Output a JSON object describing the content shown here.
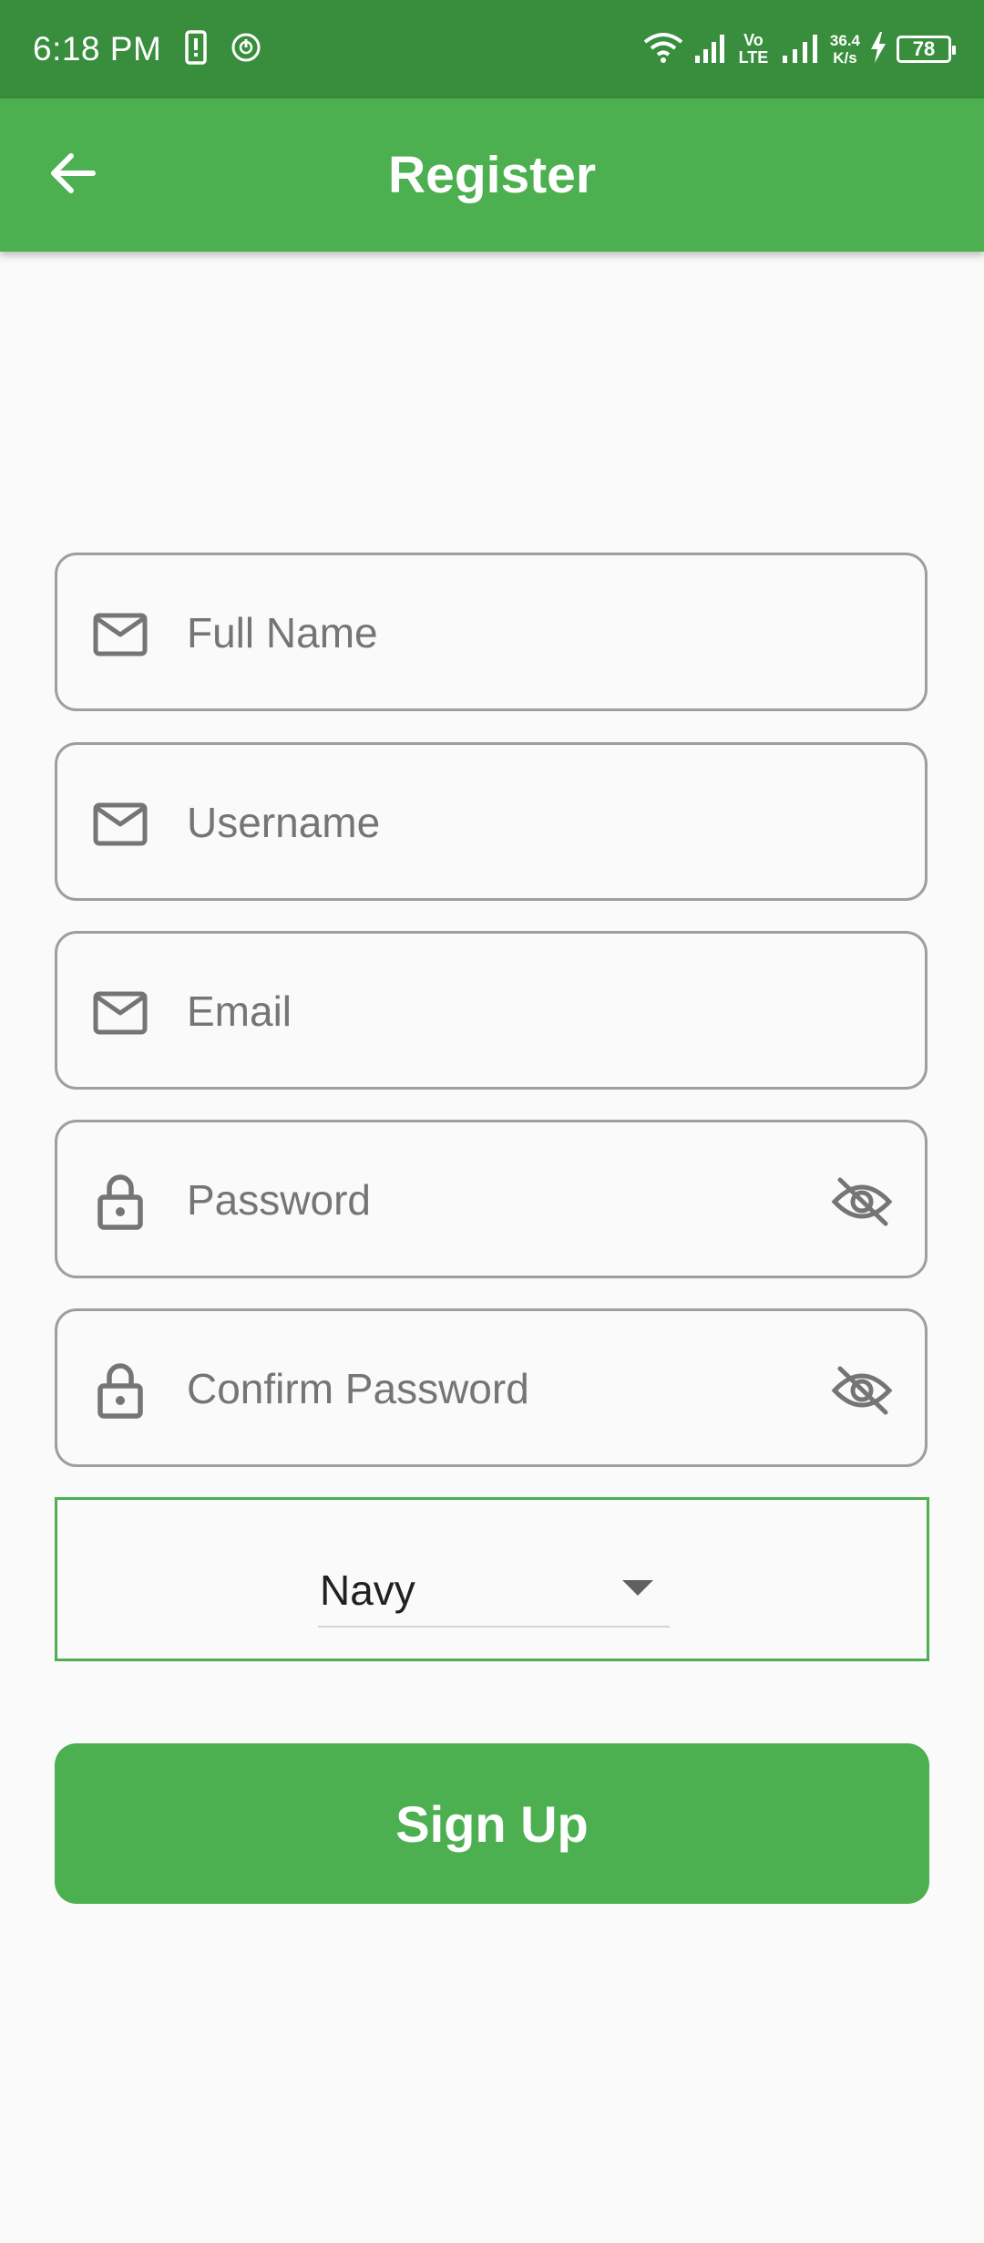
{
  "status_bar": {
    "time": "6:18 PM",
    "network_type": "Vo LTE",
    "net_speed_value": "36.4",
    "net_speed_unit": "K/s",
    "battery_level": "78",
    "icons": [
      "sim-alert-icon",
      "circle-power-icon",
      "wifi-icon",
      "signal-icon",
      "signal-icon",
      "charging-icon",
      "battery-icon"
    ]
  },
  "app_bar": {
    "title": "Register",
    "back_icon": "arrow-left-icon",
    "color": "#4caf50"
  },
  "form": {
    "fields": [
      {
        "placeholder": "Full Name",
        "value": "",
        "icon": "mail-icon"
      },
      {
        "placeholder": "Username",
        "value": "",
        "icon": "mail-icon"
      },
      {
        "placeholder": "Email",
        "value": "",
        "icon": "mail-icon"
      },
      {
        "placeholder": "Password",
        "value": "",
        "icon": "lock-icon",
        "trailing_icon": "eye-off-icon"
      },
      {
        "placeholder": "Confirm Password",
        "value": "",
        "icon": "lock-icon",
        "trailing_icon": "eye-off-icon"
      }
    ],
    "dropdown": {
      "selected": "Navy",
      "border_color": "#4caf50"
    },
    "submit_label": "Sign Up"
  },
  "colors": {
    "status_bar": "#388e3c",
    "primary": "#4caf50",
    "background": "#fafafa",
    "field_border": "#9e9e9e"
  }
}
